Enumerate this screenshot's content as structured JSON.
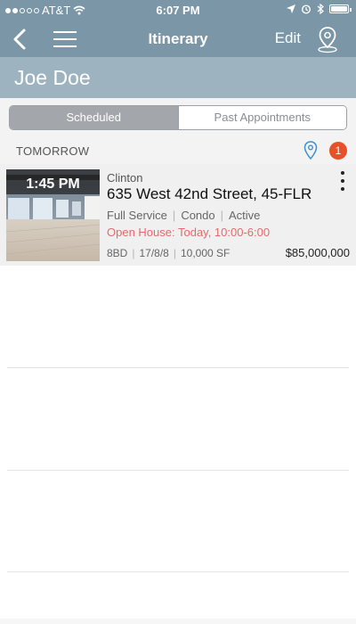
{
  "status_bar": {
    "carrier": "AT&T",
    "time": "6:07 PM"
  },
  "nav": {
    "title": "Itinerary",
    "edit_label": "Edit"
  },
  "client": {
    "name": "Joe Doe"
  },
  "tabs": {
    "items": [
      {
        "label": "Scheduled",
        "selected": true
      },
      {
        "label": "Past Appointments",
        "selected": false
      }
    ]
  },
  "day": {
    "label": "TOMORROW",
    "badge_count": "1"
  },
  "listing": {
    "time": "1:45 PM",
    "neighborhood": "Clinton",
    "address": "635 West 42nd Street, 45-FLR",
    "service": "Full Service",
    "type": "Condo",
    "status": "Active",
    "open_house": "Open House: Today, 10:00-6:00",
    "beds": "8BD",
    "rooms": "17/8/8",
    "sqft": "10,000 SF",
    "price": "$85,000,000"
  },
  "colors": {
    "nav_bg": "#7b96a6",
    "header_bg": "#9db3bf",
    "badge": "#e8502a",
    "open_house_text": "#e46a6a",
    "pin_blue": "#3a8fd8"
  }
}
